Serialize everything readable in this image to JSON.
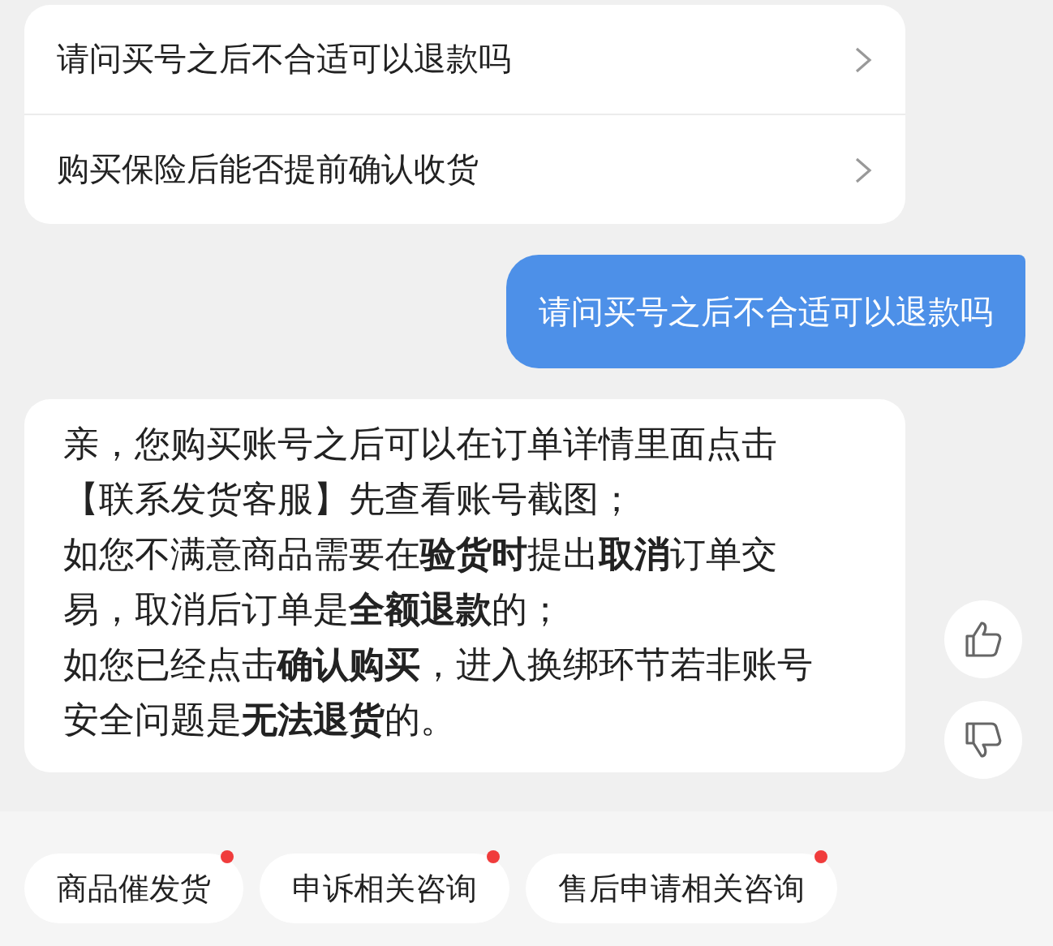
{
  "faq_card": {
    "items": [
      {
        "label": "请问买号之后不合适可以退款吗"
      },
      {
        "label": "购买保险后能否提前确认收货"
      }
    ]
  },
  "messages": [
    {
      "kind": "user",
      "lines": [
        "请问买号之后不合适可以退款吗"
      ]
    },
    {
      "kind": "bot",
      "lines": [
        "亲，您购买账号之后可以在订单详情里面点击",
        "【联系发货客服】先查看账号截图；",
        "如您不满意商品需要在**验货时**提出**取消**订单交",
        "易，取消后订单是**全额退款**的；",
        "如您已经点击**确认购买**，进入换绑环节若非账号",
        "安全问题是**无法退货**的。"
      ]
    }
  ],
  "quick_replies": [
    {
      "label": "商品催发货",
      "badge": true
    },
    {
      "label": "申诉相关咨询",
      "badge": true
    },
    {
      "label": "售后申请相关咨询",
      "badge": true
    }
  ]
}
